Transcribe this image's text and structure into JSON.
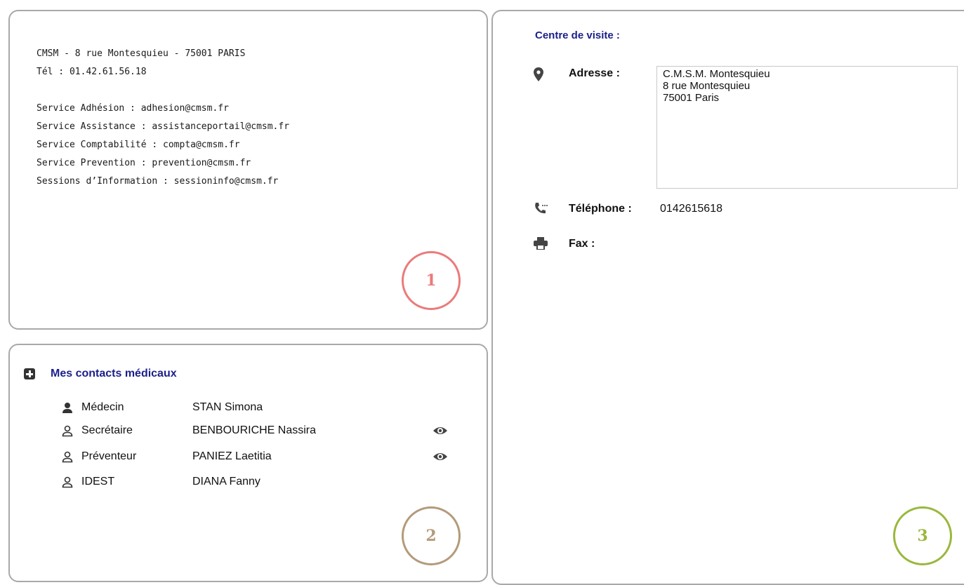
{
  "panel1": {
    "address": "CMSM - 8 rue Montesquieu - 75001 PARIS",
    "phone": "Tél : 01.42.61.56.18",
    "services": [
      "Service Adhésion : adhesion@cmsm.fr",
      "Service Assistance : assistanceportail@cmsm.fr",
      "Service Comptabilité : compta@cmsm.fr",
      "Service Prevention : prevention@cmsm.fr",
      "Sessions d’Information : sessioninfo@cmsm.fr"
    ],
    "badge": "1"
  },
  "panel2": {
    "title": "Mes contacts médicaux",
    "contacts": [
      {
        "role": "Médecin",
        "name": "STAN Simona",
        "icon": "person-filled-icon",
        "eye": false
      },
      {
        "role": "Secrétaire",
        "name": "BENBOURICHE Nassira",
        "icon": "person-outline-icon",
        "eye": true
      },
      {
        "role": "Préventeur",
        "name": "PANIEZ Laetitia",
        "icon": "person-outline-icon",
        "eye": true
      },
      {
        "role": "IDEST",
        "name": "DIANA Fanny",
        "icon": "person-outline-icon",
        "eye": false
      }
    ],
    "badge": "2"
  },
  "panel3": {
    "title": "Centre de visite :",
    "address_label": "Adresse :",
    "address_lines": [
      "C.M.S.M. Montesquieu",
      "8 rue Montesquieu",
      "75001 Paris"
    ],
    "phone_label": "Téléphone :",
    "phone_value": "0142615618",
    "fax_label": "Fax :",
    "badge": "3"
  },
  "colors": {
    "title_blue": "#1b1f8a",
    "badge1": "#ea7b7b",
    "badge2": "#b39b7a",
    "badge3": "#9ab83c",
    "panel_border": "#a9a9a9"
  }
}
